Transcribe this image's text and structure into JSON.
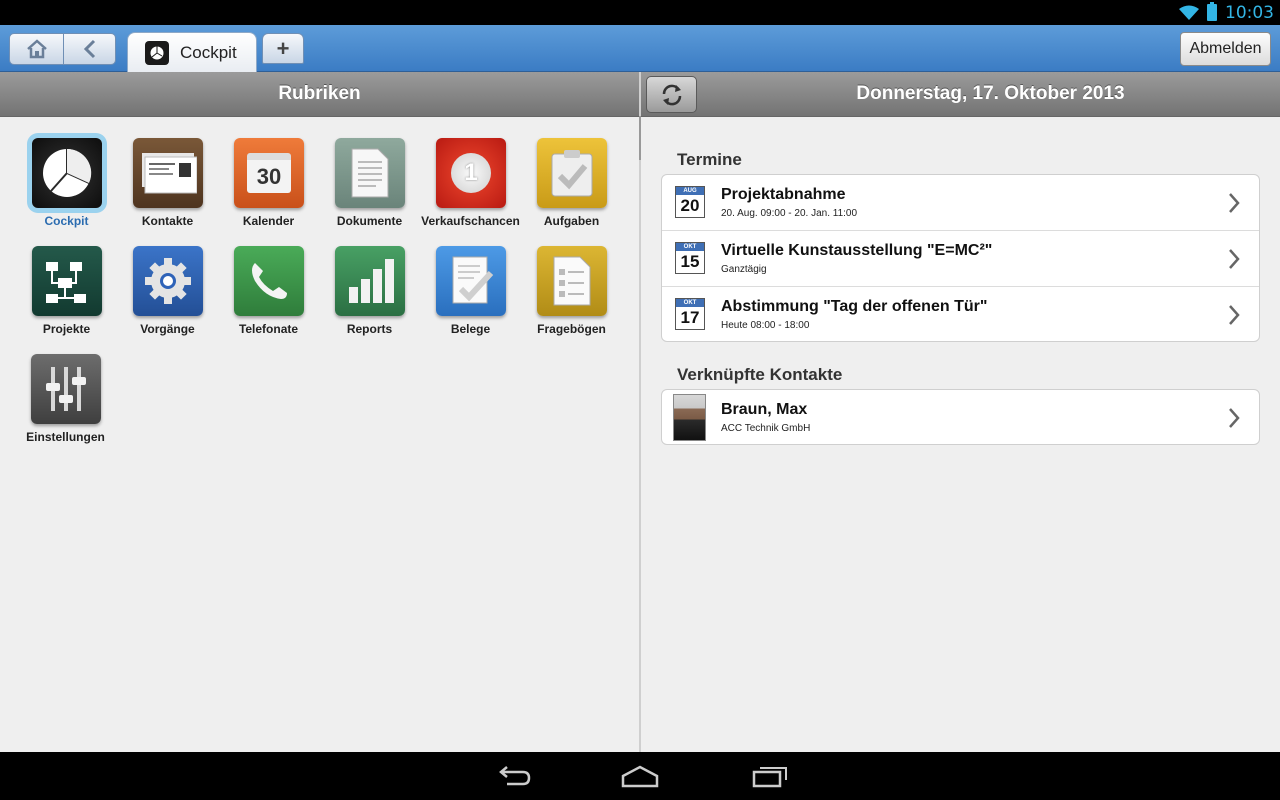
{
  "statusbar": {
    "time": "10:03",
    "icons": [
      "wifi-icon",
      "battery-icon"
    ]
  },
  "tabbar": {
    "home_icon": "home-icon",
    "back_icon": "back-icon",
    "active_tab": {
      "label": "Cockpit",
      "icon": "cockpit-icon"
    },
    "add_tab": "+",
    "logout": "Abmelden"
  },
  "left": {
    "header": "Rubriken",
    "items": [
      {
        "label": "Cockpit",
        "icon": "pie-chart-icon",
        "selected": true,
        "color": "#1c1c1c"
      },
      {
        "label": "Kontakte",
        "icon": "business-card-icon",
        "color": "#6b4a2e"
      },
      {
        "label": "Kalender",
        "icon": "calendar-icon",
        "color": "#e06a2a"
      },
      {
        "label": "Dokumente",
        "icon": "document-icon",
        "color": "#7f9a8e"
      },
      {
        "label": "Verkaufschancen",
        "icon": "badge-one-icon",
        "color": "#d8281e"
      },
      {
        "label": "Aufgaben",
        "icon": "clipboard-check-icon",
        "color": "#e2b526"
      },
      {
        "label": "Projekte",
        "icon": "flowchart-icon",
        "color": "#1d4c3e"
      },
      {
        "label": "Vorgänge",
        "icon": "gear-icon",
        "color": "#2f63b8"
      },
      {
        "label": "Telefonate",
        "icon": "phone-icon",
        "color": "#3c9a4a"
      },
      {
        "label": "Reports",
        "icon": "bar-chart-icon",
        "color": "#3a8a56"
      },
      {
        "label": "Belege",
        "icon": "receipt-check-icon",
        "color": "#3a86d6"
      },
      {
        "label": "Fragebögen",
        "icon": "questionnaire-icon",
        "color": "#d1aa2a"
      },
      {
        "label": "Einstellungen",
        "icon": "sliders-icon",
        "color": "#5a5a5a"
      }
    ],
    "calendar_day": "30",
    "opportunity_number": "1"
  },
  "right": {
    "header": "Donnerstag, 17. Oktober 2013",
    "refresh_icon": "refresh-icon",
    "appointments_title": "Termine",
    "appointments": [
      {
        "month": "AUG",
        "day": "20",
        "title": "Projektabnahme",
        "subtitle": "20. Aug. 09:00 - 20. Jan. 11:00"
      },
      {
        "month": "OKT",
        "day": "15",
        "title": "Virtuelle Kunstausstellung \"E=MC²\"",
        "subtitle": "Ganztägig"
      },
      {
        "month": "OKT",
        "day": "17",
        "title": "Abstimmung \"Tag der offenen Tür\"",
        "subtitle": "Heute 08:00 - 18:00"
      }
    ],
    "contacts_title": "Verknüpfte Kontakte",
    "contacts": [
      {
        "name": "Braun, Max",
        "company": "ACC Technik GmbH"
      }
    ]
  },
  "navbar": {
    "icons": [
      "back-nav-icon",
      "home-nav-icon",
      "recent-apps-icon"
    ]
  }
}
